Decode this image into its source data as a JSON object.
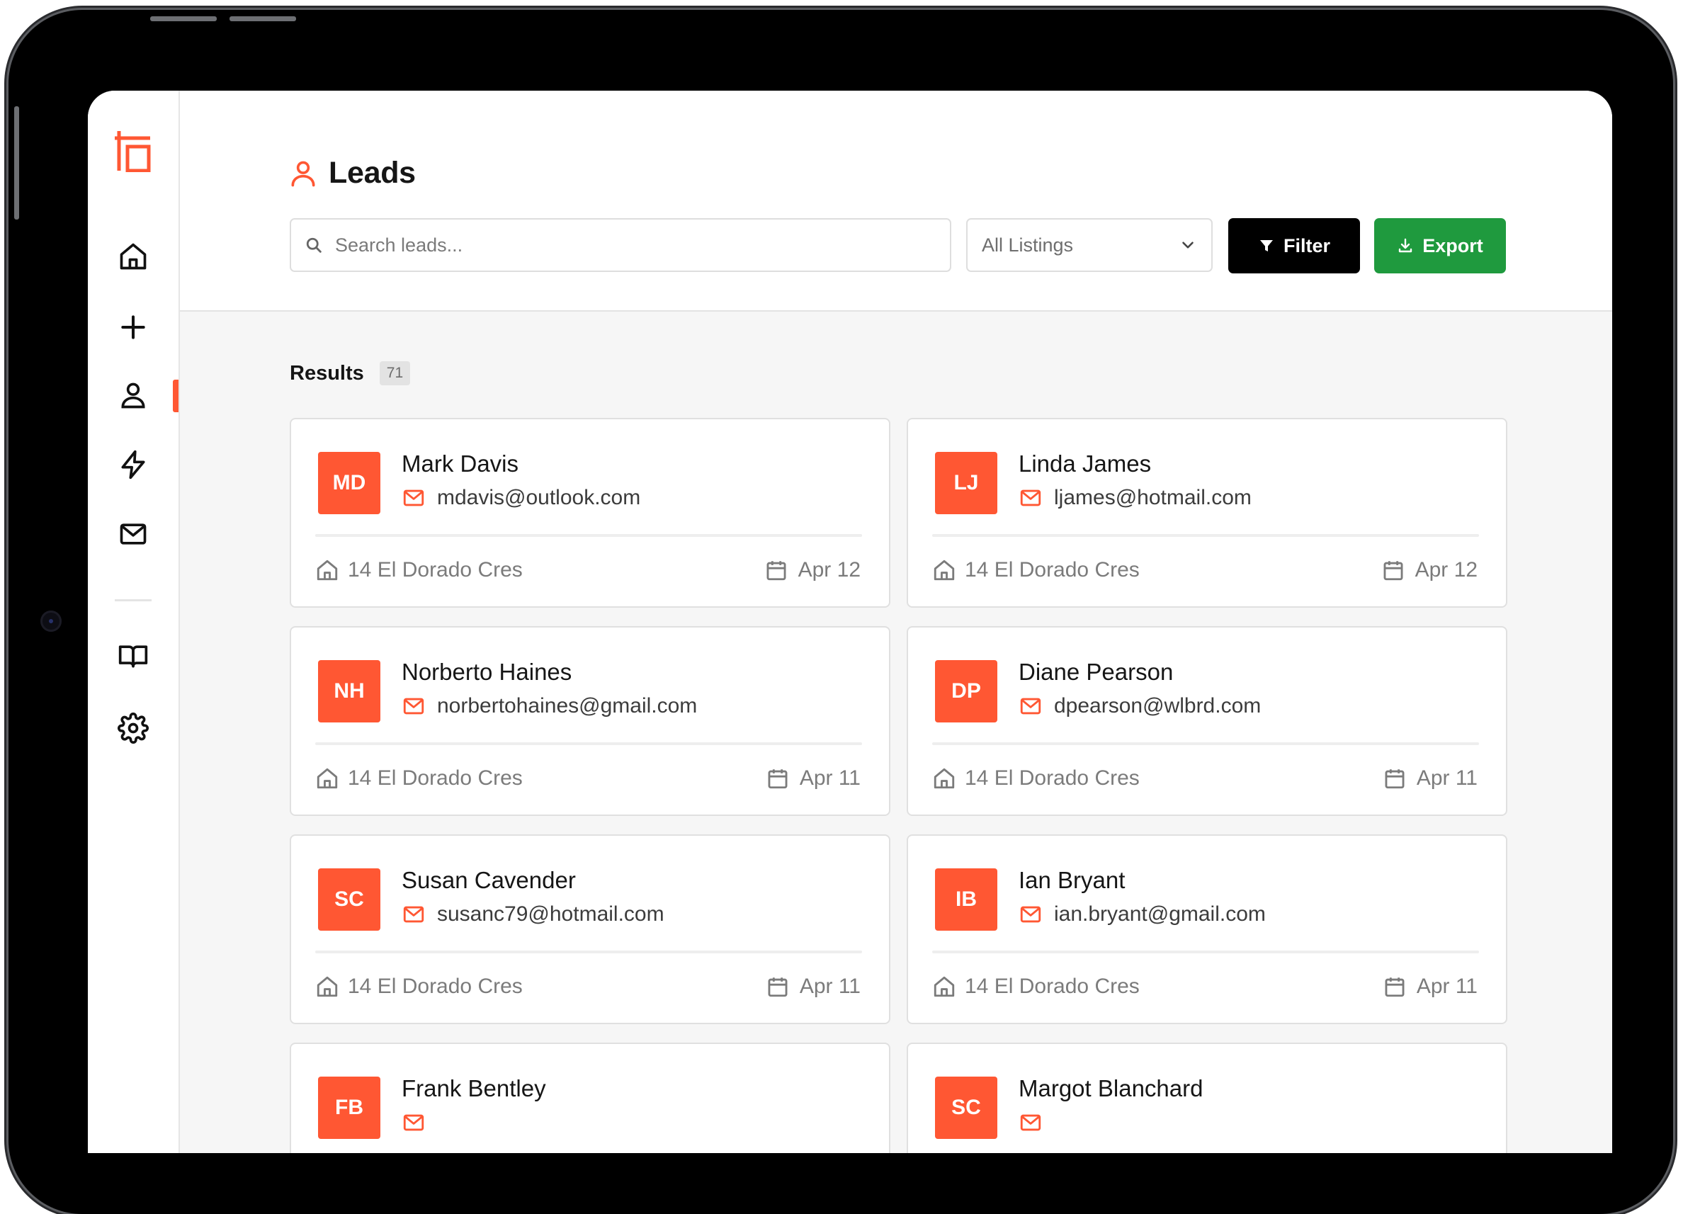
{
  "page": {
    "title": "Leads"
  },
  "sidebar": {
    "items": [
      {
        "name": "home",
        "icon": "home-icon"
      },
      {
        "name": "add",
        "icon": "plus-icon"
      },
      {
        "name": "leads",
        "icon": "user-icon",
        "active": true
      },
      {
        "name": "automations",
        "icon": "lightning-icon"
      },
      {
        "name": "messages",
        "icon": "mail-icon"
      },
      {
        "name": "guides",
        "icon": "book-icon"
      },
      {
        "name": "settings",
        "icon": "gear-icon"
      }
    ],
    "accent": "#ff5733"
  },
  "toolbar": {
    "search_placeholder": "Search leads...",
    "listing_select": "All Listings",
    "filter_label": "Filter",
    "export_label": "Export"
  },
  "results": {
    "label": "Results",
    "count": "71"
  },
  "leads": [
    {
      "initials": "MD",
      "name": "Mark Davis",
      "email": "mdavis@outlook.com",
      "address": "14 El Dorado Cres",
      "date": "Apr 12"
    },
    {
      "initials": "LJ",
      "name": "Linda James",
      "email": "ljames@hotmail.com",
      "address": "14 El Dorado Cres",
      "date": "Apr 12"
    },
    {
      "initials": "NH",
      "name": "Norberto Haines",
      "email": "norbertohaines@gmail.com",
      "address": "14 El Dorado Cres",
      "date": "Apr 11"
    },
    {
      "initials": "DP",
      "name": "Diane Pearson",
      "email": "dpearson@wlbrd.com",
      "address": "14 El Dorado Cres",
      "date": "Apr 11"
    },
    {
      "initials": "SC",
      "name": "Susan Cavender",
      "email": "susanc79@hotmail.com",
      "address": "14 El Dorado Cres",
      "date": "Apr 11"
    },
    {
      "initials": "IB",
      "name": "Ian Bryant",
      "email": "ian.bryant@gmail.com",
      "address": "14 El Dorado Cres",
      "date": "Apr 11"
    },
    {
      "initials": "FB",
      "name": "Frank Bentley",
      "email": "",
      "address": "",
      "date": ""
    },
    {
      "initials": "SC",
      "name": "Margot Blanchard",
      "email": "",
      "address": "",
      "date": ""
    }
  ],
  "colors": {
    "accent": "#ff5733",
    "filter_button": "#000000",
    "export_button": "#1f9a3e"
  }
}
